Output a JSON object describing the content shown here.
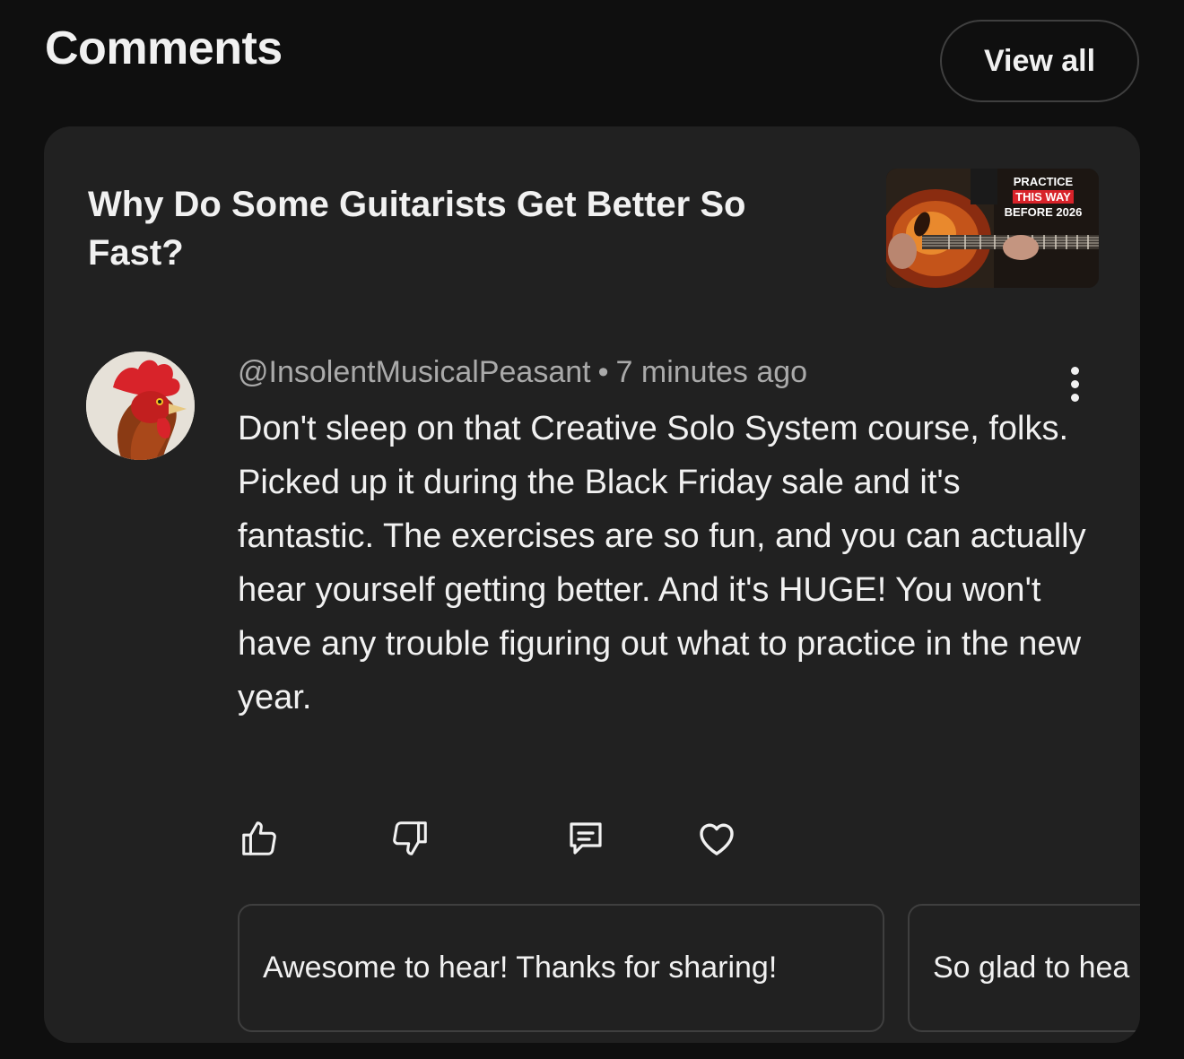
{
  "header": {
    "title": "Comments",
    "view_all_label": "View all"
  },
  "video": {
    "title": "Why Do Some Guitarists Get Better So Fast?",
    "thumbnail": {
      "line1": "PRACTICE",
      "line2": "THIS WAY",
      "line3": "BEFORE 2026"
    }
  },
  "comment": {
    "author": "@InsolentMusicalPeasant",
    "separator": "•",
    "time": "7 minutes ago",
    "text": "Don't sleep on that Creative Solo System course, folks.  Picked up it during the Black Friday sale and it's fantastic.  The exercises are so fun, and you can actually hear yourself getting better.  And it's HUGE! You won't have any trouble figuring out what to practice in the new year.",
    "actions": [
      "thumbs-up-icon",
      "thumbs-down-icon",
      "reply-icon",
      "heart-icon"
    ]
  },
  "suggested_replies": [
    "Awesome to hear! Thanks for sharing!",
    "So glad to hea"
  ],
  "colors": {
    "page_bg": "#0f0f0f",
    "card_bg": "#212121",
    "text_primary": "#f1f1f1",
    "text_secondary": "#aaaaaa",
    "border": "#3f3f3f",
    "thumb_accent": "#d8232a"
  }
}
